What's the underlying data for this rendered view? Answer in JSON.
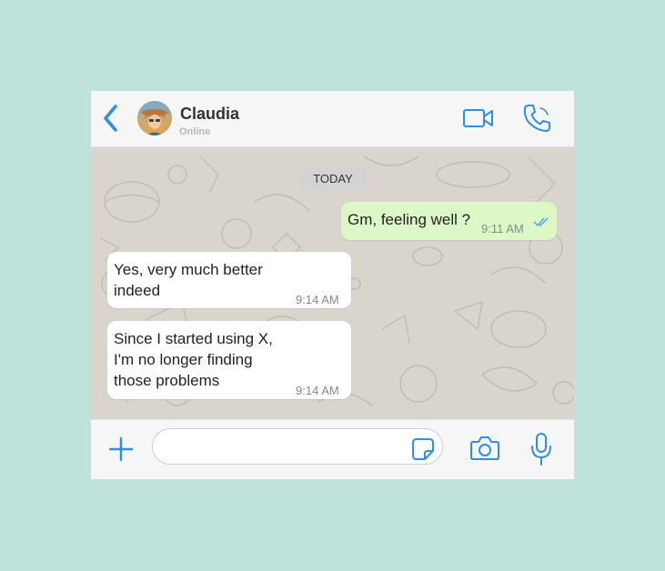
{
  "colors": {
    "accent": "#2f8ee6",
    "background": "#bee3db",
    "outgoing_bubble": "#dcf8c6",
    "incoming_bubble": "#ffffff",
    "chat_wallpaper": "#d9d4cc"
  },
  "header": {
    "back_icon": "chevron-left-icon",
    "contact_name": "Claudia",
    "contact_status": "Online",
    "video_icon": "video-camera-icon",
    "call_icon": "phone-icon"
  },
  "chat": {
    "date_label": "TODAY",
    "messages": [
      {
        "direction": "outgoing",
        "text": "Gm, feeling well ?",
        "time": "9:11 AM",
        "status_icon": "double-check-icon"
      },
      {
        "direction": "incoming",
        "text": "Yes, very much better\nindeed",
        "time": "9:14 AM"
      },
      {
        "direction": "incoming",
        "text": "Since I started using X,\nI'm no longer finding\nthose problems",
        "time": "9:14 AM"
      }
    ]
  },
  "composer": {
    "plus_icon": "plus-icon",
    "input_value": "",
    "sticker_icon": "sticker-icon",
    "camera_icon": "camera-icon",
    "mic_icon": "microphone-icon"
  }
}
